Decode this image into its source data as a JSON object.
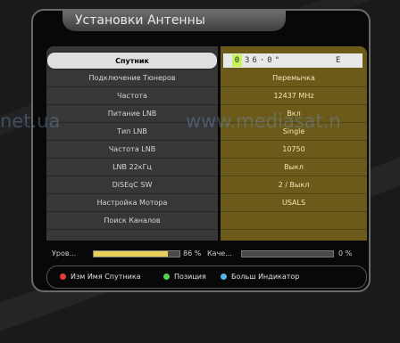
{
  "title": "Установки Антенны",
  "menu": [
    {
      "label": "Спутник",
      "value": ""
    },
    {
      "label": "Подключение Тюнеров",
      "value": "Перемычка"
    },
    {
      "label": "Частота",
      "value": "12437 MHz"
    },
    {
      "label": "Питание LNB",
      "value": "Вкл"
    },
    {
      "label": "Тип LNB",
      "value": "Single"
    },
    {
      "label": "Частота LNB",
      "value": "10750"
    },
    {
      "label": "LNB 22кГц",
      "value": "Выкл"
    },
    {
      "label": "DiSEqC SW",
      "value": "2 / Выкл"
    },
    {
      "label": "Настройка Мотора",
      "value": "USALS"
    },
    {
      "label": "Поиск Каналов",
      "value": ""
    }
  ],
  "satellite": {
    "cursor_digit": "0",
    "rest": "36·0°",
    "direction": "E"
  },
  "signal": {
    "level_label": "Уров...",
    "level_value": "86 %",
    "level_fraction": 0.86,
    "quality_label": "Каче...",
    "quality_value": "0 %",
    "quality_fraction": 0.0
  },
  "legend": {
    "red": "Изм Имя Спутника",
    "green": "Позиция",
    "blue": "Больш Индикатор"
  },
  "watermark": {
    "left": "net.ua",
    "right": "www.mediasat.n"
  },
  "colors": {
    "selected_bg": "#e0e0e0",
    "value_column_bg": "#6b5a19",
    "level_bar": "#e8cf5a",
    "cursor": "#c6f25a"
  }
}
